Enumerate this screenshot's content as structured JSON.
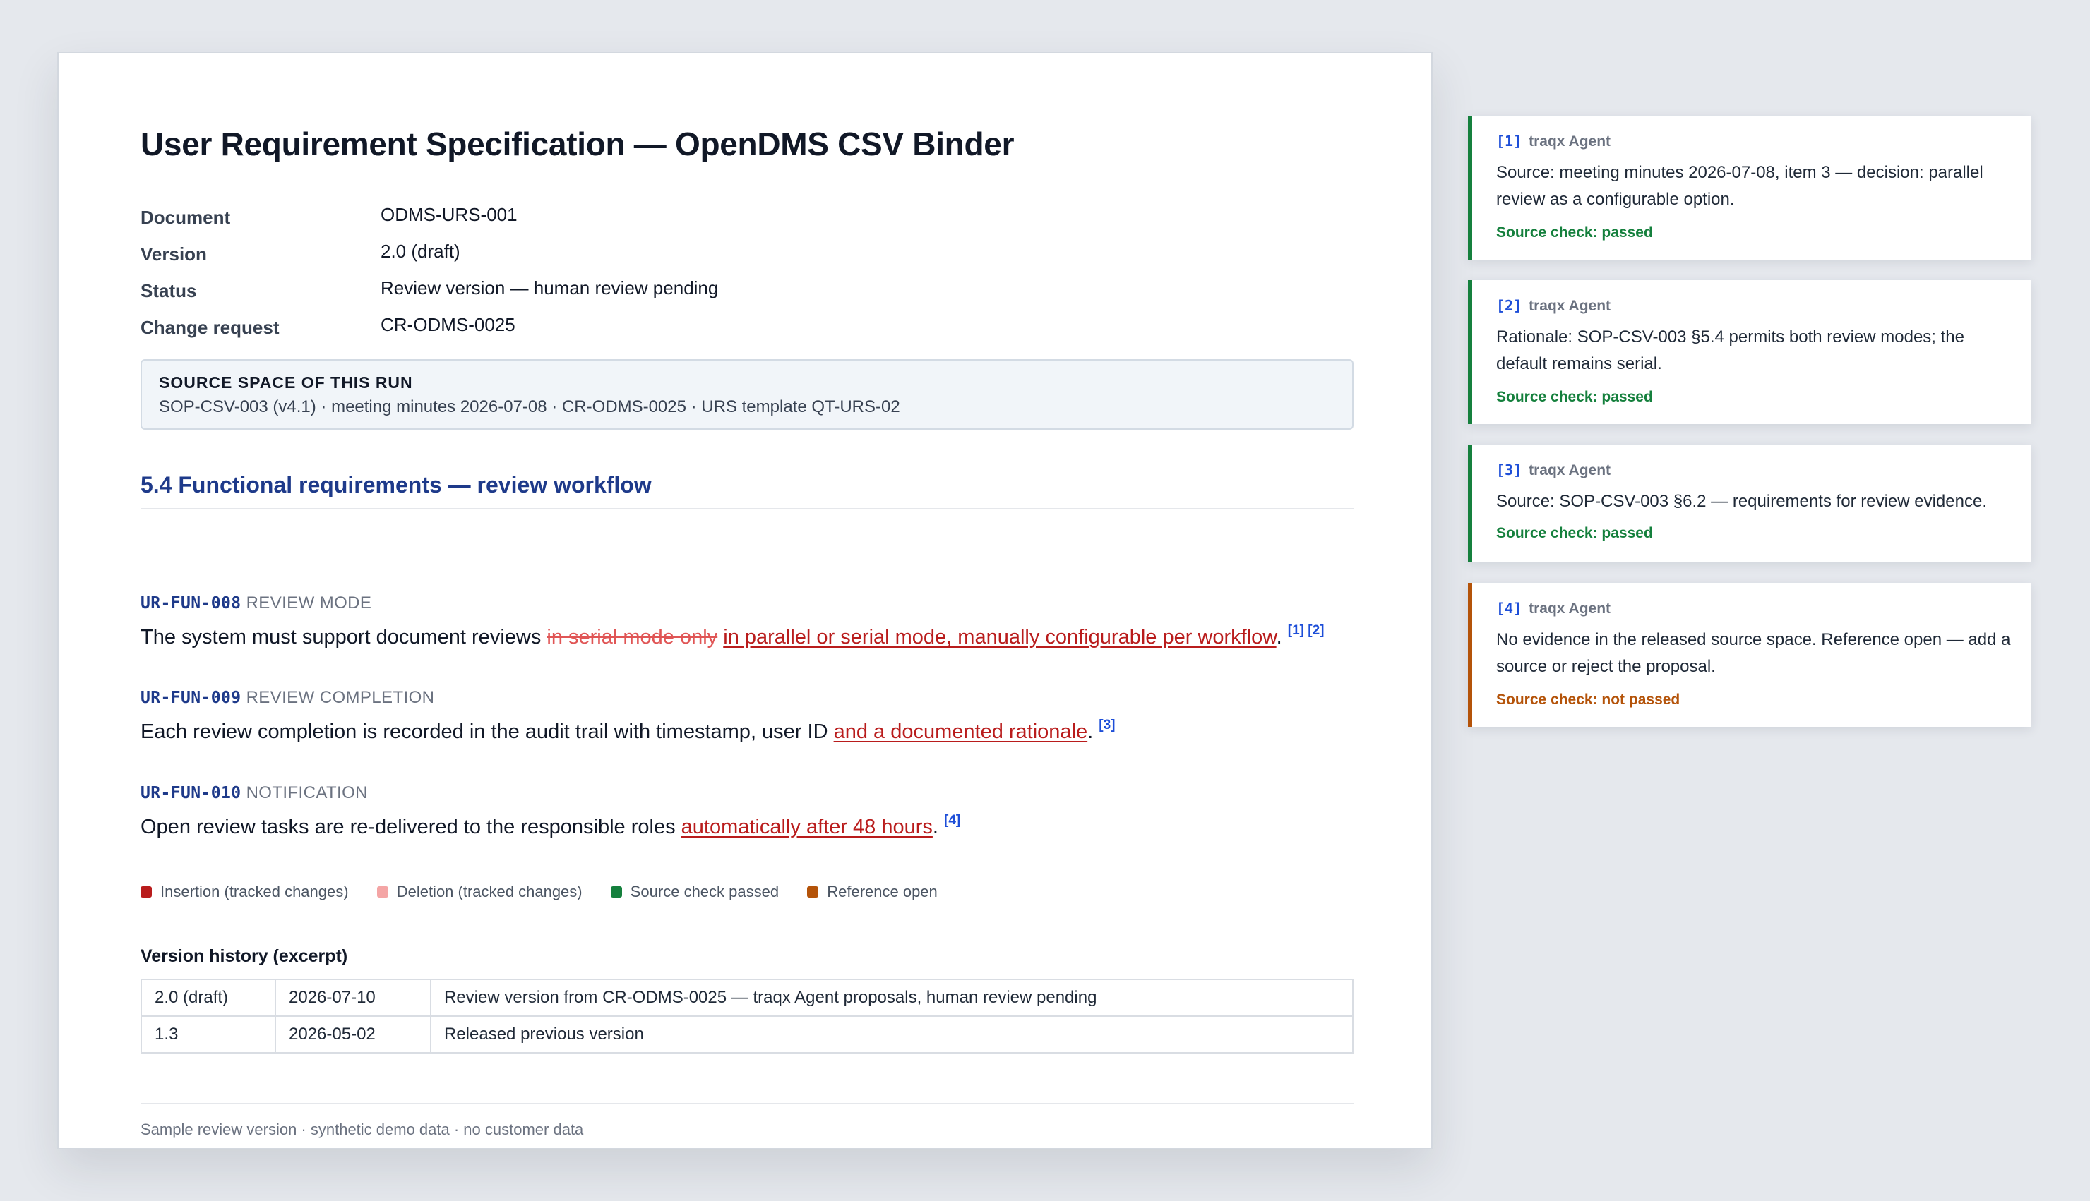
{
  "document": {
    "title": "User Requirement Specification — OpenDMS CSV Binder",
    "meta": [
      {
        "label": "Document",
        "value": "ODMS-URS-001"
      },
      {
        "label": "Version",
        "value": "2.0 (draft)"
      },
      {
        "label": "Status",
        "value": "Review version — human review pending"
      },
      {
        "label": "Change request",
        "value": "CR-ODMS-0025"
      }
    ],
    "source_space": {
      "title": "SOURCE SPACE OF THIS RUN",
      "text": "SOP-CSV-003 (v4.1) · meeting minutes 2026-07-08 · CR-ODMS-0025 · URS template QT-URS-02"
    },
    "section_title": "5.4 Functional requirements — review workflow",
    "requirements": [
      {
        "id": "UR-FUN-008",
        "label": "REVIEW MODE",
        "text_before": "The system must support document reviews ",
        "deleted": "in serial mode only",
        "inserted": "in parallel or serial mode, manually configurable per workflow",
        "text_after": ".",
        "refs": "[1] [2]"
      },
      {
        "id": "UR-FUN-009",
        "label": "REVIEW COMPLETION",
        "text_before": "Each review completion is recorded in the audit trail with timestamp, user ID ",
        "inserted": "and a documented rationale",
        "text_after": ".",
        "refs": "[3]"
      },
      {
        "id": "UR-FUN-010",
        "label": "NOTIFICATION",
        "text_before": "Open review tasks are re-delivered to the responsible roles ",
        "inserted": "automatically after 48 hours",
        "text_after": ".",
        "refs": "[4]"
      }
    ],
    "legend": [
      {
        "label": "Insertion (tracked changes)",
        "color": "#b91c1c"
      },
      {
        "label": "Deletion (tracked changes)",
        "color": "#f4a5a5"
      },
      {
        "label": "Source check passed",
        "color": "#15803d"
      },
      {
        "label": "Reference open",
        "color": "#b45309"
      }
    ],
    "version_history": {
      "title": "Version history (excerpt)",
      "rows": [
        [
          "2.0 (draft)",
          "2026-07-10",
          "Review version from CR-ODMS-0025 — traqx Agent proposals, human review pending"
        ],
        [
          "1.3",
          "2026-05-02",
          "Released previous version"
        ]
      ]
    },
    "footer": "Sample review version · synthetic demo data · no customer data"
  },
  "comments": [
    {
      "num": "[1]",
      "author": "traqx Agent",
      "body": "Source: meeting minutes 2026-07-08, item 3 — decision: parallel review as a configurable option.",
      "status": "Source check: passed",
      "color": "#15803d"
    },
    {
      "num": "[2]",
      "author": "traqx Agent",
      "body": "Rationale: SOP-CSV-003 §5.4 permits both review modes; the default remains serial.",
      "status": "Source check: passed",
      "color": "#15803d"
    },
    {
      "num": "[3]",
      "author": "traqx Agent",
      "body": "Source: SOP-CSV-003 §6.2 — requirements for review evidence.",
      "status": "Source check: passed",
      "color": "#15803d"
    },
    {
      "num": "[4]",
      "author": "traqx Agent",
      "body": "No evidence in the released source space. Reference open — add a source or reject the proposal.",
      "status": "Source check: not passed",
      "color": "#b45309"
    }
  ]
}
